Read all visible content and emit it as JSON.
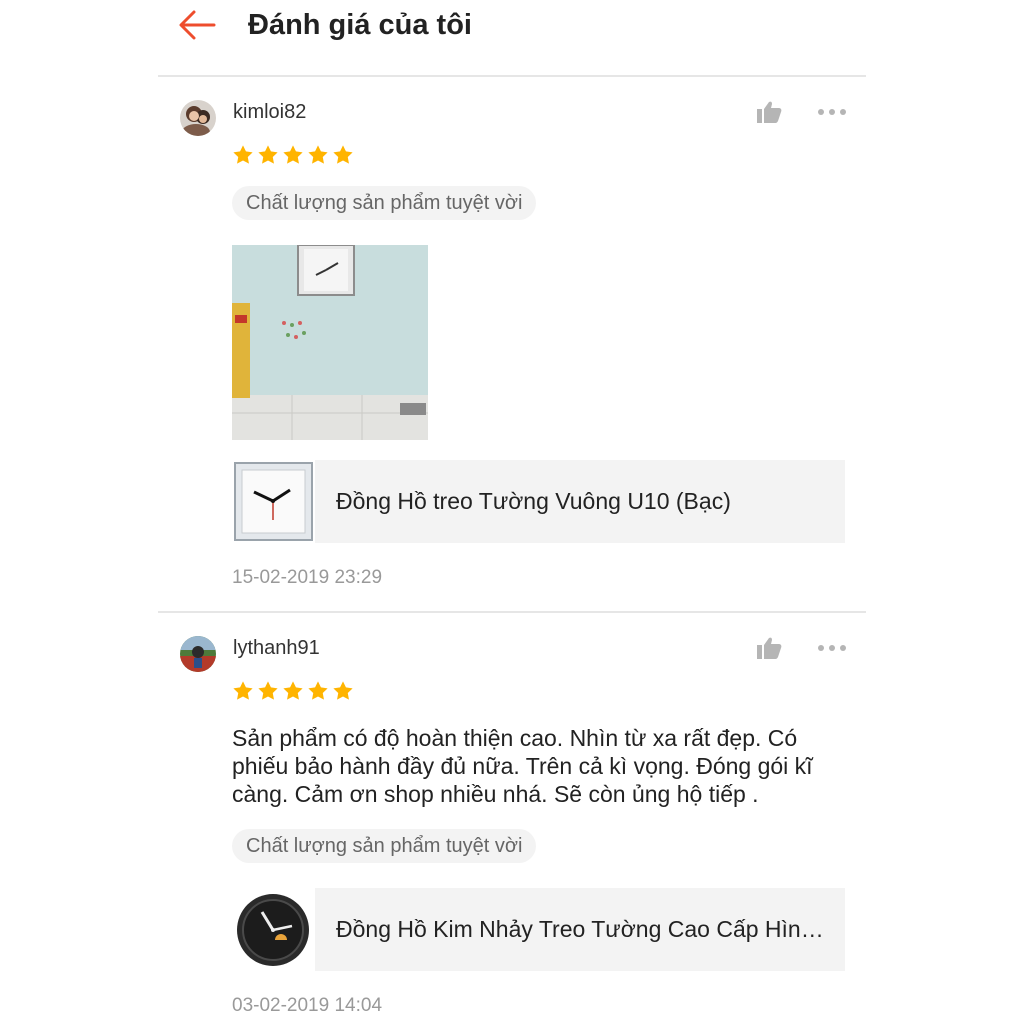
{
  "header": {
    "title": "Đánh giá của tôi",
    "accent_color": "#ee4d2d"
  },
  "reviews": [
    {
      "username": "kimloi82",
      "rating": 5,
      "tag": "Chất lượng sản phẩm tuyệt vời",
      "product_name": "Đồng Hồ treo Tường Vuông U10 (Bạc)",
      "timestamp": "15-02-2019 23:29"
    },
    {
      "username": "lythanh91",
      "rating": 5,
      "text": "Sản phẩm có độ hoàn thiện cao. Nhìn từ xa rất đẹp. Có phiếu bảo hành đầy đủ nữa. Trên cả kì vọng. Đóng gói kĩ càng. Cảm ơn shop nhiều nhá. Sẽ còn ủng hộ tiếp .",
      "tag": "Chất lượng sản phẩm tuyệt vời",
      "product_name": "Đồng Hồ Kim Nhảy Treo Tường Cao Cấp Hìn…",
      "timestamp": "03-02-2019 14:04"
    }
  ],
  "icons": {
    "back": "arrow-left-icon",
    "like": "thumbs-up-icon",
    "more": "more-horizontal-icon",
    "star": "star-icon"
  },
  "colors": {
    "star": "#ffb400",
    "icon_gray": "#b5b5b5"
  }
}
